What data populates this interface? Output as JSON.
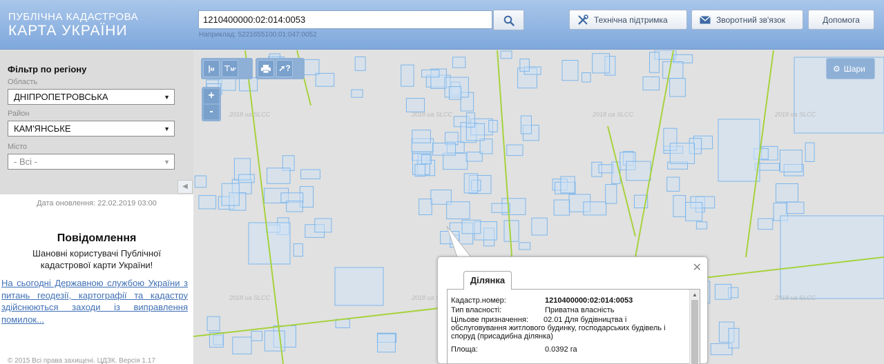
{
  "header": {
    "logo_line1": "ПУБЛІЧНА КАДАСТРОВА",
    "logo_line2": "КАРТА УКРАЇНИ",
    "search_value": "1210400000:02:014:0053",
    "search_example": "Наприклад: 5221655100:01:047:0052",
    "buttons": {
      "support": "Технічна підтримка",
      "feedback": "Зворотний зв'язок",
      "help": "Допомога"
    }
  },
  "sidebar": {
    "filter_title": "Фільтр по регіону",
    "region_label": "Область",
    "region_value": "ДНІПРОПЕТРОВСЬКА",
    "district_label": "Район",
    "district_value": "КАМ'ЯНСЬКЕ",
    "city_label": "Місто",
    "city_value": "- Всі -",
    "updated": "Дата оновлення: 22.02.2019 03:00",
    "message_title": "Повідомлення",
    "message_body": "Шановні користувачі Публічної кадастрової карти України!",
    "message_link": "На сьогодні Державною службою України з питань геодезії, картографії та кадастру здійснюються заходи із виправлення помилок...",
    "copyright": "© 2015 Всі права захищені. ЦДЗК. Версія 1.17"
  },
  "map": {
    "layers_label": "Шари",
    "watermark": "2018 ua SLCC",
    "toolbar_glyphs": {
      "measure_length": "M",
      "measure_area": "M²"
    },
    "zoom_in": "+",
    "zoom_out": "-",
    "colors": {
      "parcel_stroke": "#7db6ea",
      "parcel_fill": "#cfe3f7",
      "road": "#a6d23c",
      "background": "#e1e1e1"
    }
  },
  "popup": {
    "tab_label": "Ділянка",
    "close_glyph": "✕",
    "fields": {
      "cadastral_label": "Кадастр.номер:",
      "cadastral_value": "1210400000:02:014:0053",
      "ownership_label": "Тип власності:",
      "ownership_value": "Приватна власність",
      "purpose_label": "Цільове призначення:",
      "purpose_value": "02.01 Для будівництва і обслуговування житлового будинку, господарських будівель і споруд (присадибна ділянка)",
      "area_label": "Площа:",
      "area_value": "0.0392 га"
    }
  }
}
